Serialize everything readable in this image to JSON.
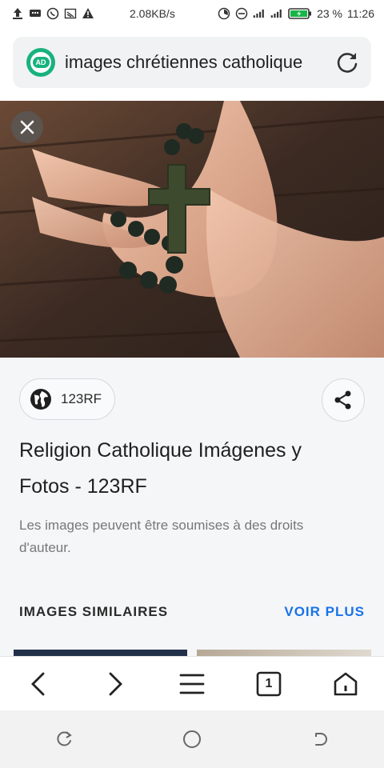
{
  "status_bar": {
    "net_speed": "2.08KB/s",
    "battery": "23 %",
    "time": "11:26",
    "icons": [
      "upload-icon",
      "message-icon",
      "whatsapp-icon",
      "cast-icon",
      "warning-icon",
      "data-saver-icon",
      "dnd-icon",
      "signal-icon",
      "signal-4g-icon",
      "battery-charging-icon"
    ]
  },
  "address_bar": {
    "badge_text": "AD",
    "url_text": "images chrétiennes catholique",
    "reload_icon": "reload-icon"
  },
  "image_viewer": {
    "close_icon": "close-icon"
  },
  "result": {
    "source_name": "123RF",
    "source_icon": "globe-icon",
    "share_icon": "share-icon",
    "title": "Religion Catholique Imágenes y Fotos - 123RF",
    "rights_notice": "Les images peuvent être soumises à des droits d'auteur."
  },
  "similar": {
    "heading": "IMAGES SIMILAIRES",
    "more_label": "VOIR PLUS",
    "more_color": "#1a73e8"
  },
  "bottom_nav": {
    "tab_count": "1",
    "items": [
      "back-icon",
      "forward-icon",
      "menu-icon",
      "tabs-icon",
      "home-icon"
    ]
  },
  "system_nav": {
    "items": [
      "recents-icon",
      "home-circle-icon",
      "back-system-icon"
    ]
  }
}
